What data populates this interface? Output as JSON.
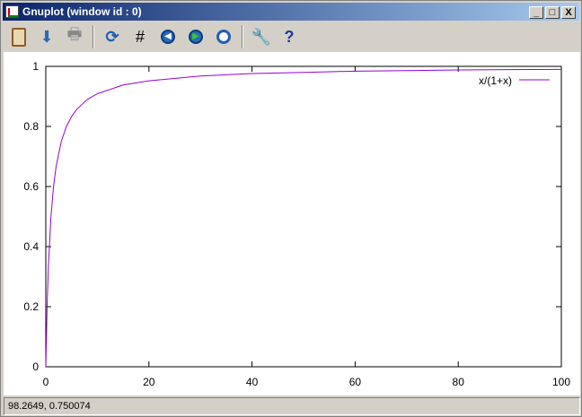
{
  "window": {
    "title": "Gnuplot (window id : 0)",
    "min": "_",
    "max": "□",
    "close": "X"
  },
  "toolbar": {
    "items": [
      "copy-to-clipboard",
      "print-to-file",
      "print",
      "replot",
      "grid",
      "zoom-previous",
      "zoom-next",
      "autoscale",
      "options",
      "help"
    ]
  },
  "status": {
    "text": "98.2649, 0.750074"
  },
  "colors": {
    "series": "#9400d3"
  },
  "chart_data": {
    "type": "line",
    "title": "",
    "xlabel": "",
    "ylabel": "",
    "xlim": [
      0,
      100
    ],
    "ylim": [
      0,
      1
    ],
    "xticks": [
      0,
      20,
      40,
      60,
      80,
      100
    ],
    "yticks": [
      0,
      0.2,
      0.4,
      0.6,
      0.8,
      1
    ],
    "xtick_labels": [
      "0",
      "20",
      "40",
      "60",
      "80",
      "100"
    ],
    "ytick_labels": [
      "0",
      "0.2",
      "0.4",
      "0.6",
      "0.8",
      "1"
    ],
    "grid": false,
    "legend": {
      "position": "top-right",
      "entries": [
        "x/(1+x)"
      ]
    },
    "series": [
      {
        "name": "x/(1+x)",
        "x": [
          0,
          0.25,
          0.5,
          1,
          1.5,
          2,
          3,
          4,
          5,
          6,
          8,
          10,
          15,
          20,
          30,
          40,
          50,
          60,
          70,
          80,
          90,
          100
        ],
        "y": [
          0,
          0.2,
          0.333,
          0.5,
          0.6,
          0.667,
          0.75,
          0.8,
          0.833,
          0.857,
          0.889,
          0.909,
          0.938,
          0.952,
          0.968,
          0.976,
          0.98,
          0.984,
          0.986,
          0.988,
          0.989,
          0.99
        ]
      }
    ]
  }
}
